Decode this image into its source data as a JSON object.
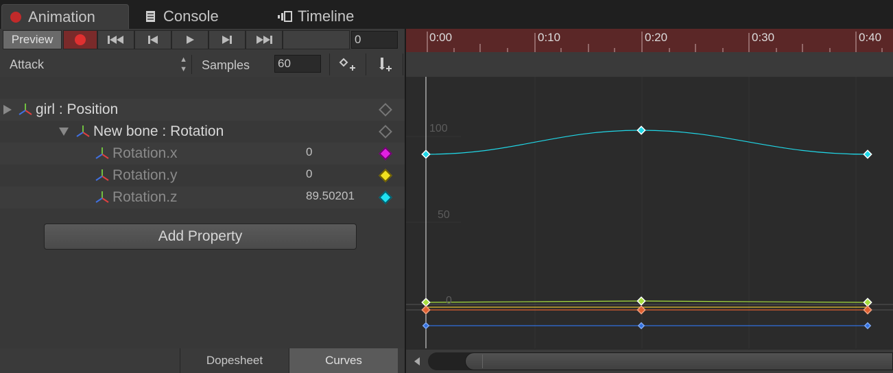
{
  "tabs": [
    {
      "label": "Animation",
      "icon": "record-dot-icon"
    },
    {
      "label": "Console",
      "icon": "console-icon"
    },
    {
      "label": "Timeline",
      "icon": "timeline-icon"
    }
  ],
  "toolbar": {
    "preview_label": "Preview",
    "frame_value": "0"
  },
  "clip": {
    "selected": "Attack",
    "samples_label": "Samples",
    "samples_value": "60"
  },
  "properties": [
    {
      "label": "girl : Position",
      "value": "",
      "expanded": false
    },
    {
      "label": "New bone : Rotation",
      "value": "",
      "expanded": true
    },
    {
      "label": "Rotation.x",
      "value": "0",
      "color": "#e020e0"
    },
    {
      "label": "Rotation.y",
      "value": "0",
      "color": "#f0e020"
    },
    {
      "label": "Rotation.z",
      "value": "89.50201",
      "color": "#20e0f0"
    }
  ],
  "add_property_label": "Add Property",
  "view_tabs": {
    "dopesheet": "Dopesheet",
    "curves": "Curves",
    "active": "Curves"
  },
  "timeline": {
    "ticks": [
      "0:00",
      "0:10",
      "0:20",
      "0:30",
      "0:40"
    ]
  },
  "graph": {
    "y_labels": [
      "100",
      "50",
      "0"
    ]
  },
  "colors": {
    "accent_record": "#c12a2a",
    "ruler_bg": "#5b2727",
    "curve_z": "#20d8e8",
    "curve_green": "#a8e040",
    "curve_orange": "#e06030",
    "curve_yellow": "#e8c030",
    "curve_blue": "#3070e0"
  }
}
